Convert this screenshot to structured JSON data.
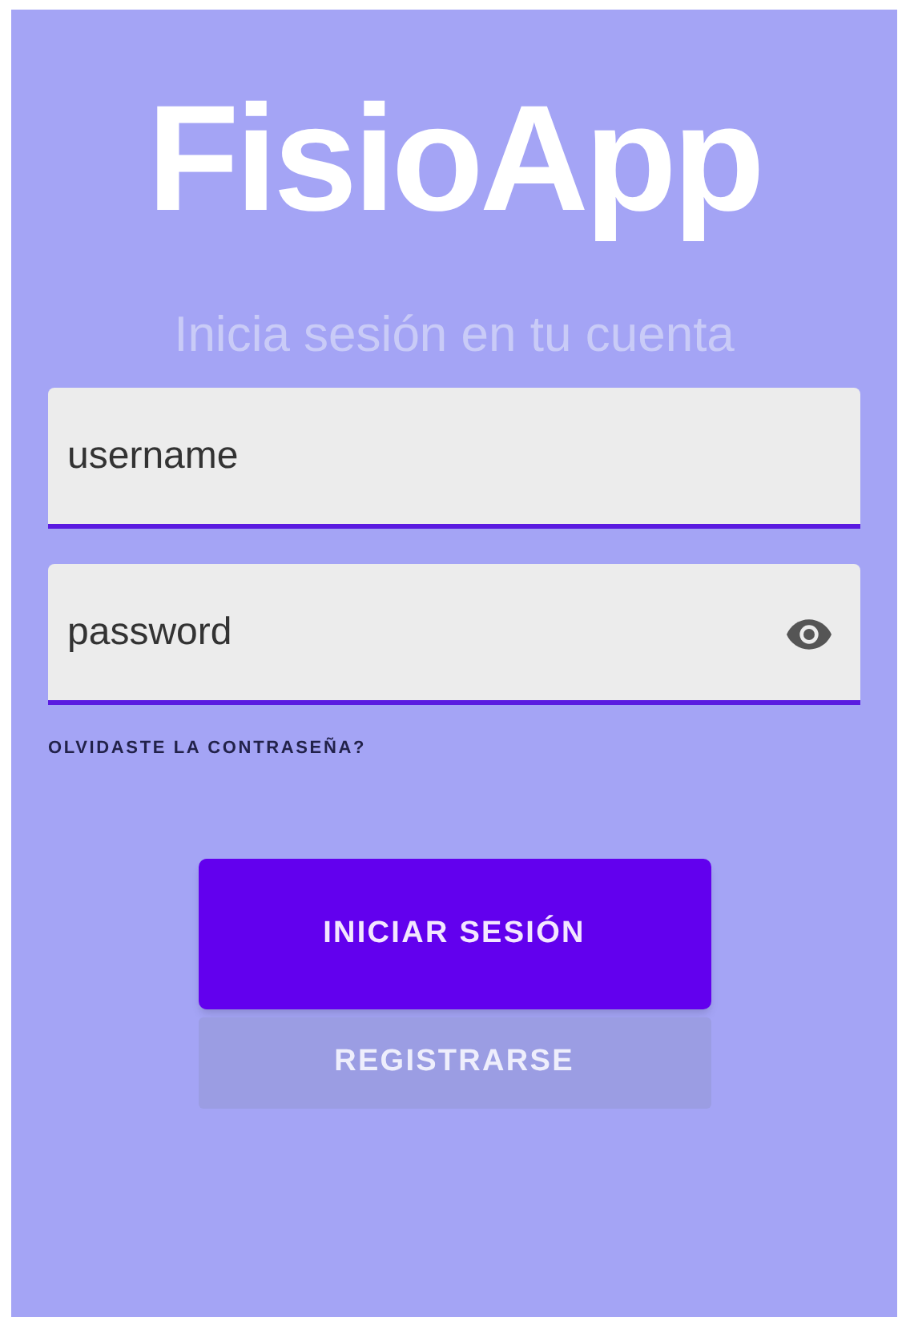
{
  "app_title": "FisioApp",
  "subtitle": "Inicia sesión en tu cuenta",
  "fields": [
    {
      "kind": "text",
      "placeholder": "username"
    },
    {
      "kind": "password",
      "placeholder": "password"
    }
  ],
  "forgot_link": "OLVIDASTE LA CONTRASEÑA?",
  "buttons": [
    {
      "kind": "primary",
      "label": "INICIAR SESIÓN"
    },
    {
      "kind": "secondary",
      "label": "REGISTRARSE"
    }
  ]
}
